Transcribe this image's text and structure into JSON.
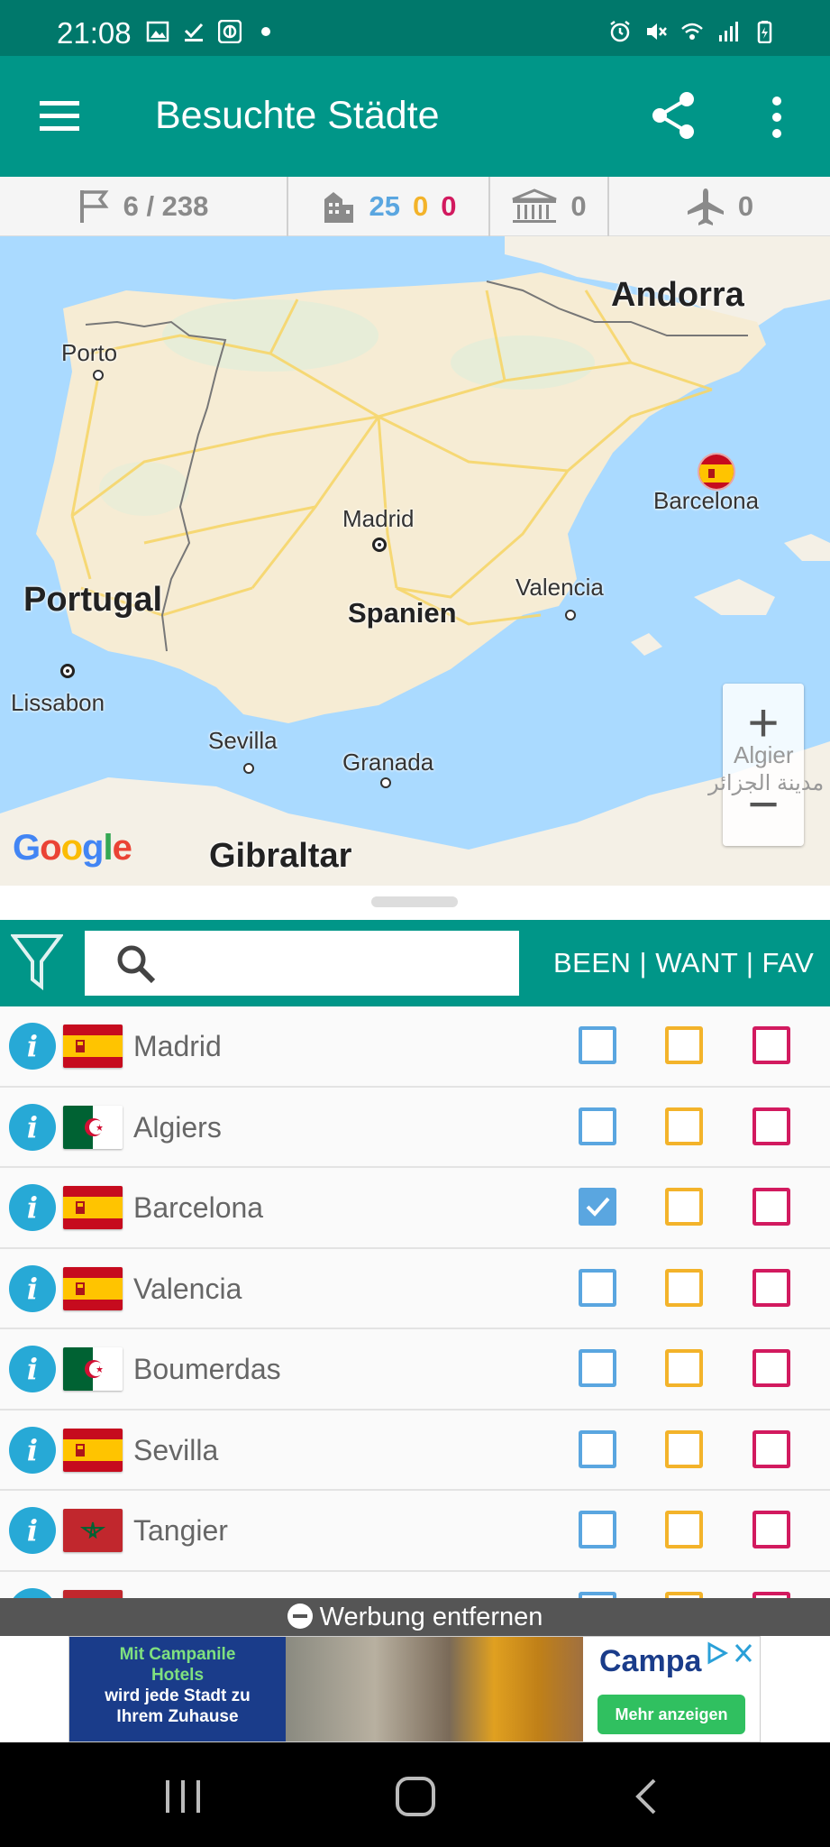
{
  "status_bar": {
    "time": "21:08",
    "left_icons": [
      "gallery-icon",
      "download-done-icon",
      "vpn-key-icon",
      "dot-icon"
    ],
    "right_icons": [
      "alarm-icon",
      "mute-icon",
      "wifi-icon",
      "signal-icon",
      "battery-charging-icon"
    ]
  },
  "app_bar": {
    "title": "Besuchte Städte",
    "color": "#009688",
    "status_color": "#00786b"
  },
  "stats": {
    "countries": "6 / 238",
    "cities_been": "25",
    "cities_want": "0",
    "cities_fav": "0",
    "unesco": "0",
    "airports": "0"
  },
  "map": {
    "labels": {
      "andorra": "Andorra",
      "porto": "Porto",
      "madrid": "Madrid",
      "barcelona": "Barcelona",
      "portugal": "Portugal",
      "spanien": "Spanien",
      "valencia": "Valencia",
      "lissabon": "Lissabon",
      "sevilla": "Sevilla",
      "granada": "Granada",
      "algier": "Algier",
      "algier_ar": "مدينة الجزائر",
      "gibraltar": "Gibraltar"
    },
    "google": [
      "G",
      "o",
      "o",
      "g",
      "l",
      "e"
    ],
    "zoom_in": "+",
    "zoom_out": "−"
  },
  "filter": {
    "search_value": "",
    "search_placeholder": "",
    "column_header": "BEEN | WANT | FAV"
  },
  "cities": [
    {
      "name": "Madrid",
      "flag": "spain",
      "been": false,
      "want": false,
      "fav": false
    },
    {
      "name": "Algiers",
      "flag": "algeria",
      "been": false,
      "want": false,
      "fav": false
    },
    {
      "name": "Barcelona",
      "flag": "spain",
      "been": true,
      "want": false,
      "fav": false
    },
    {
      "name": "Valencia",
      "flag": "spain",
      "been": false,
      "want": false,
      "fav": false
    },
    {
      "name": "Boumerdas",
      "flag": "algeria",
      "been": false,
      "want": false,
      "fav": false
    },
    {
      "name": "Sevilla",
      "flag": "spain",
      "been": false,
      "want": false,
      "fav": false
    },
    {
      "name": "Tangier",
      "flag": "morocco",
      "been": false,
      "want": false,
      "fav": false
    },
    {
      "name": "",
      "flag": "morocco",
      "been": false,
      "want": false,
      "fav": false
    }
  ],
  "info_glyph": "i",
  "ad": {
    "remove_label": "Werbung entfernen",
    "headline_1": "Mit Campanile",
    "headline_2": "Hotels",
    "headline_3": "wird jede Stadt zu",
    "headline_4": "Ihrem Zuhause",
    "brand": "Campa",
    "cta": "Mehr anzeigen"
  },
  "colors": {
    "been": "#5aa6e0",
    "want": "#f3b32a",
    "fav": "#d21a5f",
    "info": "#27a9d6"
  }
}
